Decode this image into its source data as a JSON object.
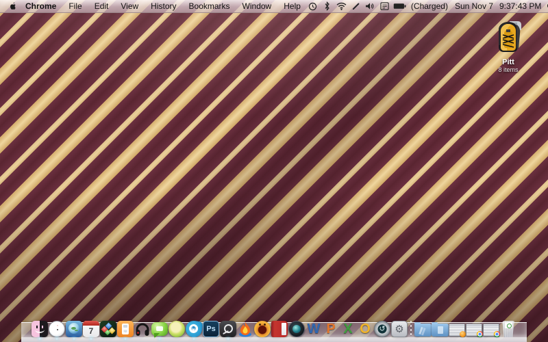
{
  "menu_bar": {
    "apple_icon": "apple-logo",
    "menus": [
      {
        "label": "Chrome",
        "bold": true
      },
      {
        "label": "File"
      },
      {
        "label": "Edit"
      },
      {
        "label": "View"
      },
      {
        "label": "History"
      },
      {
        "label": "Bookmarks"
      },
      {
        "label": "Window"
      },
      {
        "label": "Help"
      }
    ],
    "status": {
      "icons": [
        "sync-status-icon",
        "bluetooth-icon",
        "wifi-icon",
        "ink-pen-icon",
        "volume-icon",
        "input-menu-icon",
        "battery-icon"
      ],
      "battery_label": "(Charged)",
      "date": "Sun Nov 7",
      "time": "9:37:43 PM",
      "spotlight": "spotlight-search-icon"
    }
  },
  "desktop": {
    "wallpaper": {
      "pattern": "diagonal-stripes",
      "maroon": "#6b3040",
      "gold": "#dfc089"
    },
    "stack": {
      "label": "Pitt",
      "sublabel": "8 items",
      "icon": "backpack"
    }
  },
  "dock": {
    "items": [
      {
        "name": "finder",
        "running": true
      },
      {
        "name": "dashboard",
        "running": true
      },
      {
        "name": "globe-planet-app",
        "running": true
      },
      {
        "name": "ical",
        "glyph": "7",
        "running": true
      },
      {
        "name": "gem-game",
        "running": false
      },
      {
        "name": "ipod-app",
        "running": true
      },
      {
        "name": "headphones-app",
        "running": false
      },
      {
        "name": "chat-app",
        "running": true
      },
      {
        "name": "lime-app",
        "running": false
      },
      {
        "name": "drop-app",
        "running": true
      },
      {
        "name": "photoshop",
        "glyph": "Ps",
        "running": false
      },
      {
        "name": "steam",
        "running": true
      },
      {
        "name": "flame-app",
        "running": false
      },
      {
        "name": "arcade-face-app",
        "running": false
      },
      {
        "name": "red-book-app",
        "running": false
      },
      {
        "name": "photo-booth",
        "running": false
      },
      {
        "name": "word",
        "glyph": "W",
        "running": false
      },
      {
        "name": "powerpoint",
        "glyph": "P",
        "running": false
      },
      {
        "name": "excel",
        "glyph": "X",
        "running": false
      },
      {
        "name": "outlook",
        "glyph": "O",
        "running": false
      },
      {
        "name": "time-machine",
        "glyph": "↺",
        "running": false
      },
      {
        "name": "system-preferences",
        "glyph": "⚙",
        "running": false
      },
      {
        "name": "applications-folder"
      },
      {
        "name": "documents-folder"
      },
      {
        "name": "minimized-window-1",
        "badge": "orange"
      },
      {
        "name": "minimized-window-2",
        "badge": "chrome"
      },
      {
        "name": "minimized-window-3",
        "badge": "chrome"
      },
      {
        "name": "trash",
        "state": "full"
      }
    ]
  }
}
